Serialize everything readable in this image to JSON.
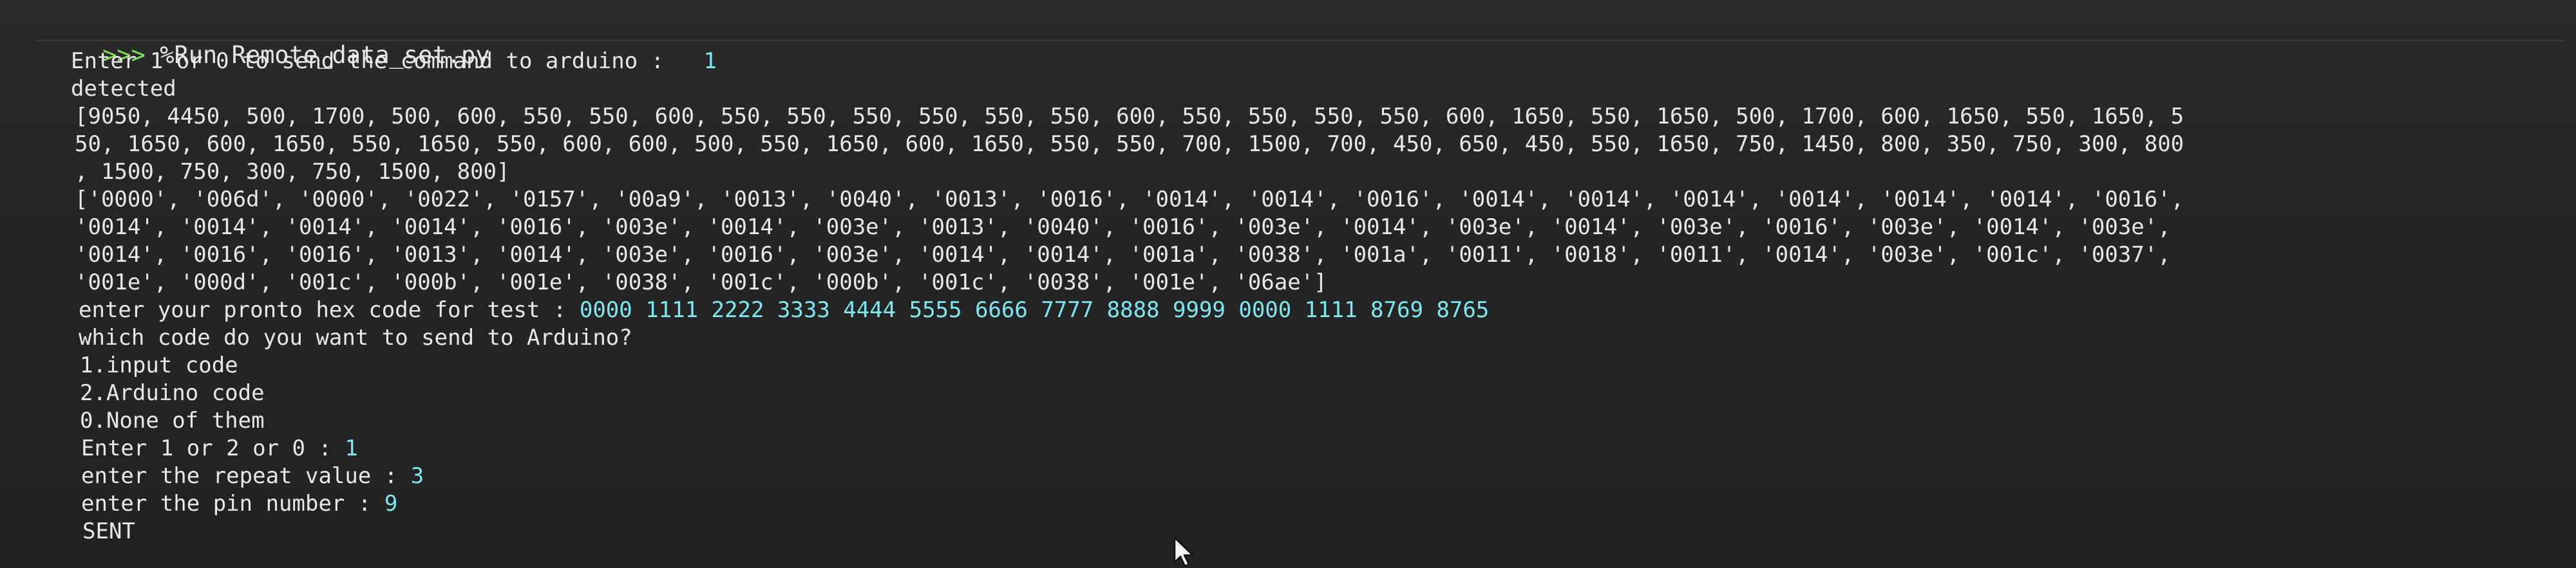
{
  "header": {
    "prompt": ">>>",
    "command": " %Run Remote_data_set.py"
  },
  "console": {
    "lines": [
      {
        "text": "Enter 1 or 0 to send the command to arduino :   ",
        "input": "1"
      },
      {
        "text": "detected",
        "input": ""
      },
      {
        "text": "[9050, 4450, 500, 1700, 500, 600, 550, 550, 600, 550, 550, 550, 550, 550, 550, 600, 550, 550, 550, 550, 600, 1650, 550, 1650, 500, 1700, 600, 1650, 550, 1650, 5",
        "input": ""
      },
      {
        "text": "50, 1650, 600, 1650, 550, 1650, 550, 600, 600, 500, 550, 1650, 600, 1650, 550, 550, 700, 1500, 700, 450, 650, 450, 550, 1650, 750, 1450, 800, 350, 750, 300, 800",
        "input": ""
      },
      {
        "text": ", 1500, 750, 300, 750, 1500, 800]",
        "input": ""
      },
      {
        "text": "['0000', '006d', '0000', '0022', '0157', '00a9', '0013', '0040', '0013', '0016', '0014', '0014', '0016', '0014', '0014', '0014', '0014', '0014', '0014', '0016',",
        "input": ""
      },
      {
        "text": "'0014', '0014', '0014', '0014', '0016', '003e', '0014', '003e', '0013', '0040', '0016', '003e', '0014', '003e', '0014', '003e', '0016', '003e', '0014', '003e',",
        "input": ""
      },
      {
        "text": "'0014', '0016', '0016', '0013', '0014', '003e', '0016', '003e', '0014', '0014', '001a', '0038', '001a', '0011', '0018', '0011', '0014', '003e', '001c', '0037',",
        "input": ""
      },
      {
        "text": "'001e', '000d', '001c', '000b', '001e', '0038', '001c', '000b', '001c', '0038', '001e', '06ae']",
        "input": ""
      },
      {
        "text": "enter your pronto hex code for test : ",
        "input": "0000 1111 2222 3333 4444 5555 6666 7777 8888 9999 0000 1111 8769 8765"
      },
      {
        "text": "which code do you want to send to Arduino?",
        "input": ""
      },
      {
        "text": "1.input code",
        "input": ""
      },
      {
        "text": "2.Arduino code",
        "input": ""
      },
      {
        "text": "0.None of them",
        "input": ""
      },
      {
        "text": "Enter 1 or 2 or 0 : ",
        "input": "1"
      },
      {
        "text": "enter the repeat value : ",
        "input": "3"
      },
      {
        "text": "enter the pin number : ",
        "input": "9"
      },
      {
        "text": "SENT",
        "input": ""
      }
    ]
  },
  "colors": {
    "background": "#242424",
    "text": "#e8e8e8",
    "prompt": "#7fe45a",
    "user_input": "#7ee7f0"
  },
  "icons": {
    "cursor": "mouse-pointer-icon"
  }
}
